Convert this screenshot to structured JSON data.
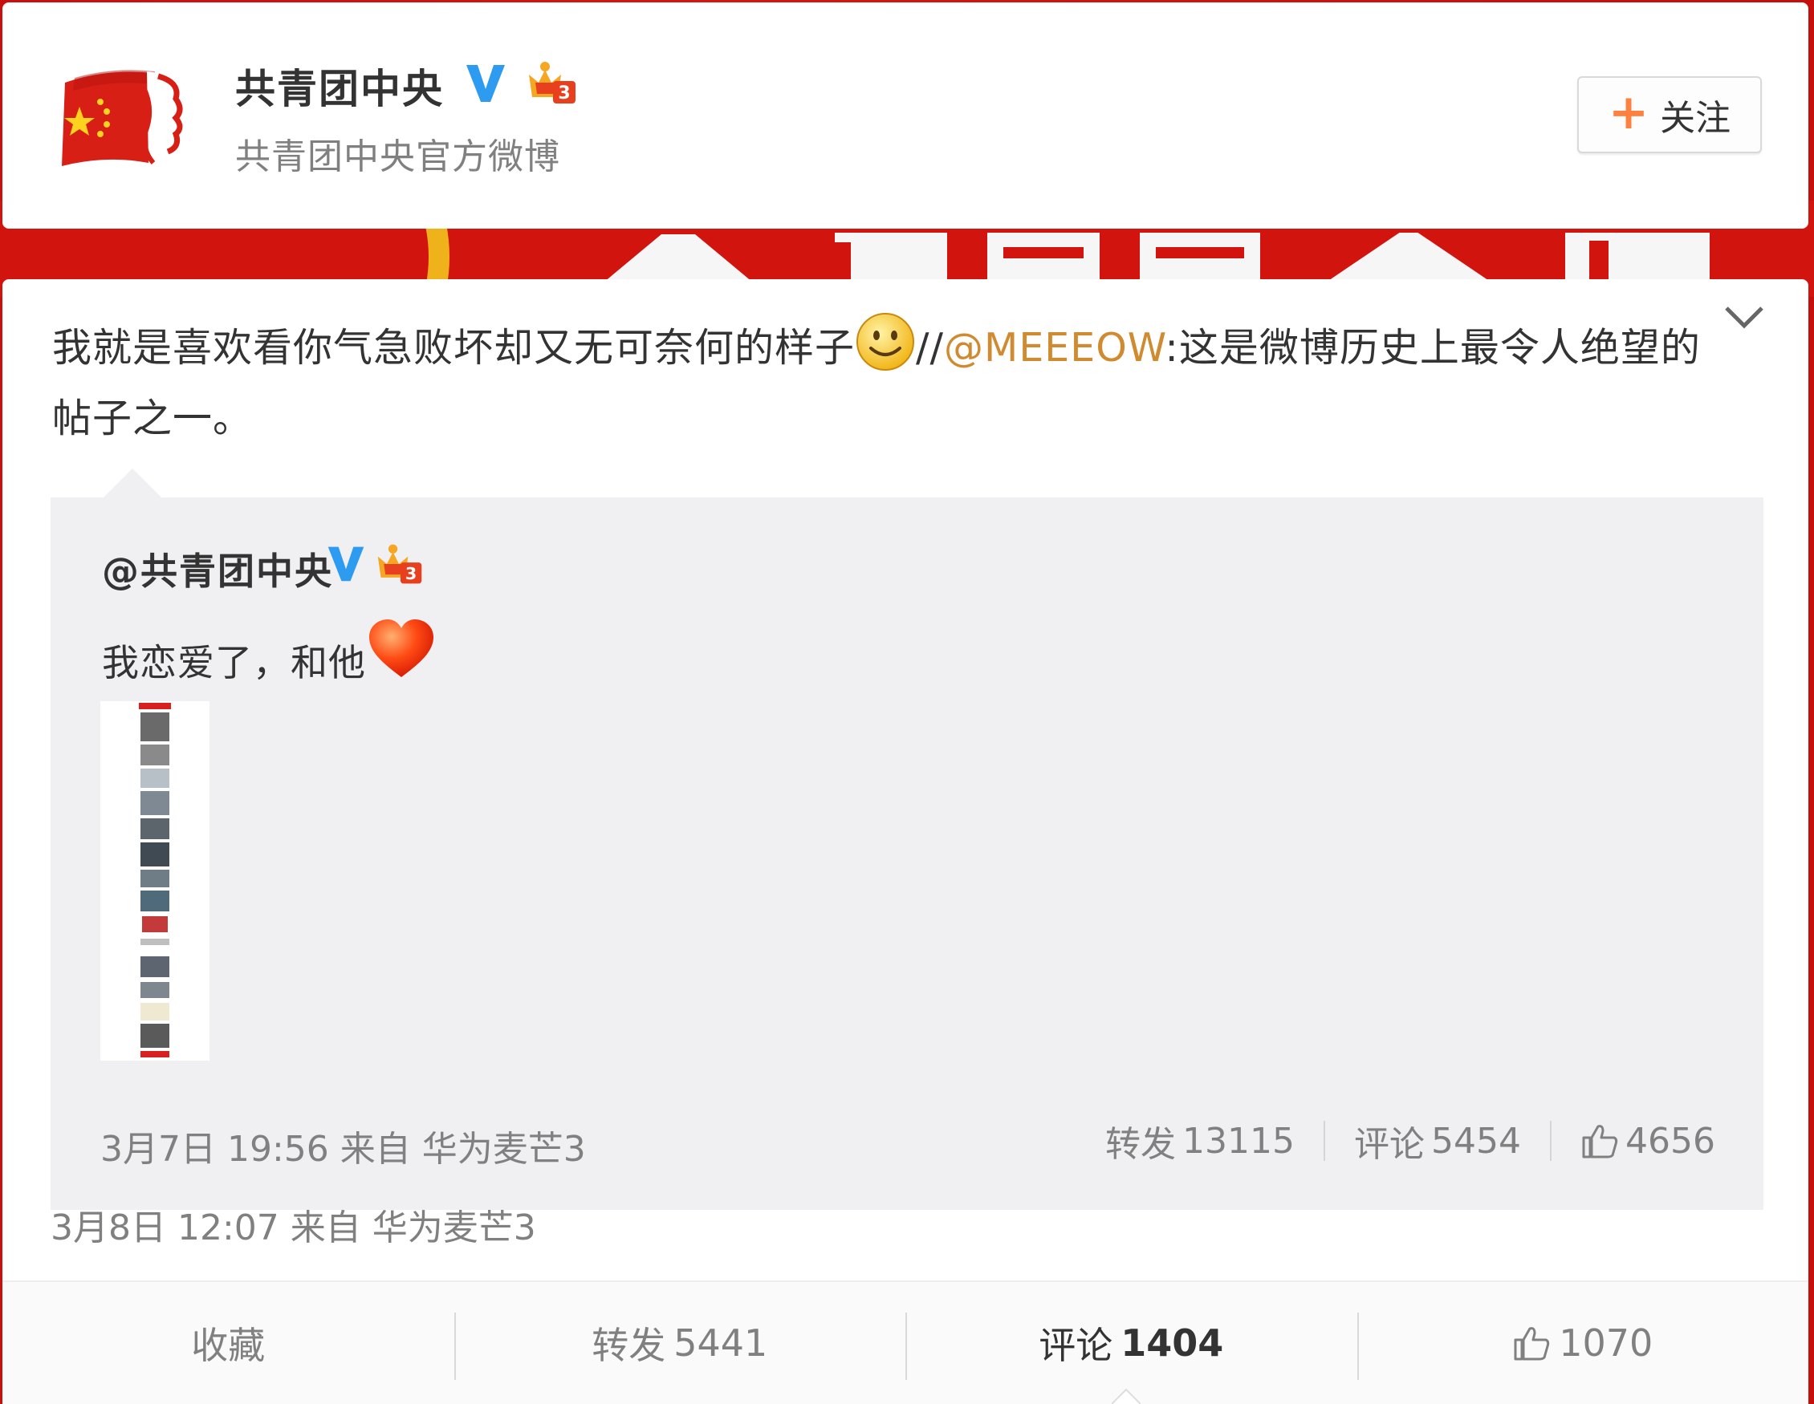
{
  "header": {
    "user_name": "共青团中央",
    "user_desc": "共青团中央官方微博",
    "follow_label": "关注",
    "follow_plus": "+"
  },
  "post": {
    "text_main": "我就是喜欢看你气急败坏却又无可奈何的样子",
    "separator": "//",
    "mention": "@MEEEOW",
    "text_quote": ":这是微博历史上最令人绝望的帖子之一。",
    "time": "3月8日 12:07",
    "source_prefix": "来自",
    "source": "华为麦芒3"
  },
  "repost": {
    "user_name": "@共青团中央",
    "text": "我恋爱了，和他",
    "time": "3月7日 19:56",
    "source_prefix": "来自",
    "source": "华为麦芒3",
    "forward_label": "转发",
    "forward_count": "13115",
    "comment_label": "评论",
    "comment_count": "5454",
    "like_count": "4656"
  },
  "actions": {
    "favorite_label": "收藏",
    "forward_label": "转发",
    "forward_count": "5441",
    "comment_label": "评论",
    "comment_count": "1404",
    "like_count": "1070"
  },
  "colors": {
    "mention": "#d08a30",
    "follow_plus": "#ff8140",
    "verified": "#2d9cf0",
    "banner_red": "#d2140f"
  },
  "icons": [
    "flag-avatar-icon",
    "verified-icon",
    "member-crown-icon",
    "chevron-down-icon",
    "smile-emoji-icon",
    "heart-icon",
    "thumbs-up-icon"
  ]
}
